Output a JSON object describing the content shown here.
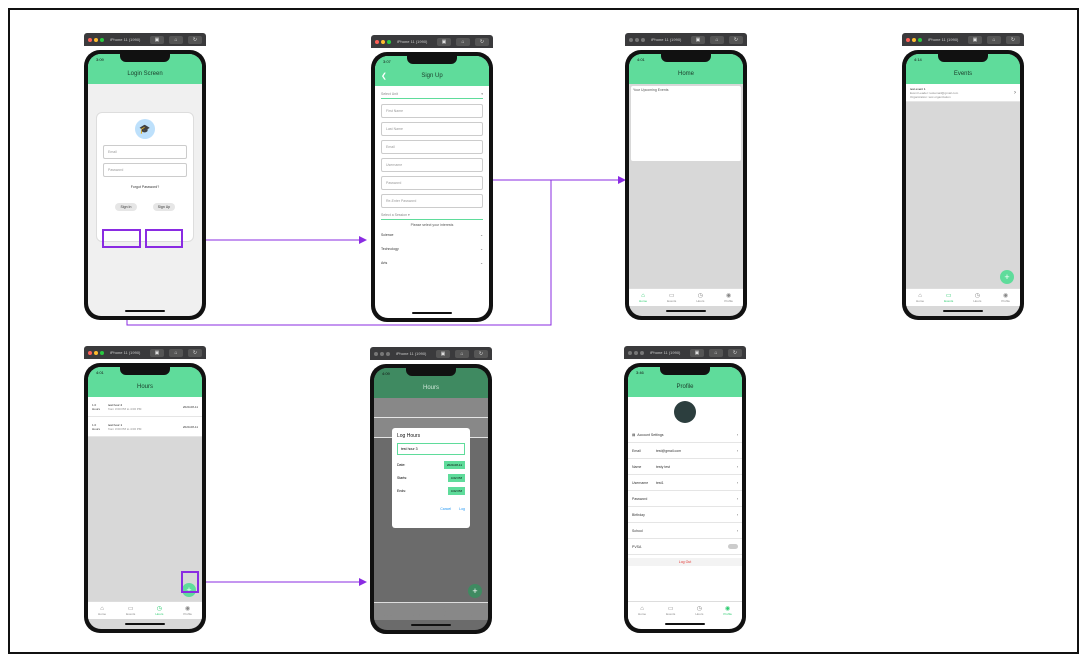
{
  "devices": {
    "login": {
      "window_title": "iPhone 11 (1990)",
      "time": "3:09",
      "title": "Login Screen",
      "email_placeholder": "Email",
      "password_placeholder": "Password",
      "forgot": "Forgot Password?",
      "signin": "Sign In",
      "signup": "Sign Up"
    },
    "signup": {
      "window_title": "iPhone 11 (1990)",
      "time": "3:07",
      "title": "Sign Up",
      "select_unit": "Select Unit",
      "fields": [
        "First Name",
        "Last Name",
        "Email",
        "Username",
        "Password",
        "Re-Enter Password"
      ],
      "select_session": "Select a Session",
      "interests_label": "Please select your interests",
      "interests": [
        "Science",
        "Technology",
        "Arts"
      ]
    },
    "home": {
      "window_title": "iPhone 11 (1990)",
      "time": "4:01",
      "title": "Home",
      "upcoming": "Your Upcoming Events",
      "tabs": [
        "Home",
        "Events",
        "Hours",
        "Profile"
      ]
    },
    "events": {
      "window_title": "iPhone 11 (1990)",
      "time": "4:14",
      "title": "Events",
      "event_title": "test event 1",
      "event_line1": "Event Leader: testemail@gmail.com",
      "event_line2": "Organization: test organization",
      "tabs": [
        "Home",
        "Events",
        "Hours",
        "Profile"
      ]
    },
    "hours": {
      "window_title": "iPhone 11 (1990)",
      "time": "4:01",
      "title": "Hours",
      "rows": [
        {
          "hours": "1.0 Hours",
          "name": "test hour 2",
          "time": "from 3:00 PM to 4:00 PM",
          "date": "2020-08-11"
        },
        {
          "hours": "1.0 Hours",
          "name": "test hour 1",
          "time": "from 3:00 PM to 4:00 PM",
          "date": "2020-08-11"
        }
      ],
      "tabs": [
        "Home",
        "Events",
        "Hours",
        "Profile"
      ]
    },
    "loghours": {
      "window_title": "iPhone 11 (1990)",
      "time": "4:09",
      "title": "Hours",
      "dialog_title": "Log Hours",
      "name_value": "test hour 3",
      "date_label": "Date:",
      "date_value": "2020-08-11",
      "starts_label": "Starts:",
      "starts_value": "4:02 PM",
      "ends_label": "Ends:",
      "ends_value": "4:02 PM",
      "cancel": "Cancel",
      "log": "Log",
      "tabs": [
        "Home",
        "Events",
        "Hours",
        "Profile"
      ]
    },
    "profile": {
      "window_title": "iPhone 11 (1990)",
      "time": "3:46",
      "title": "Profile",
      "account_settings": "Account Settings",
      "rows": [
        {
          "label": "Email",
          "value": "test@gmail.com"
        },
        {
          "label": "Name",
          "value": "testy test"
        },
        {
          "label": "Username",
          "value": "test1"
        },
        {
          "label": "Password",
          "value": ""
        },
        {
          "label": "Birthday",
          "value": ""
        },
        {
          "label": "School",
          "value": ""
        },
        {
          "label": "PVSA",
          "value": ""
        }
      ],
      "logout": "Log Out",
      "tabs": [
        "Home",
        "Events",
        "Hours",
        "Profile"
      ]
    }
  },
  "colors": {
    "accent": "#5fdc9b",
    "arrow": "#8a2be2"
  }
}
